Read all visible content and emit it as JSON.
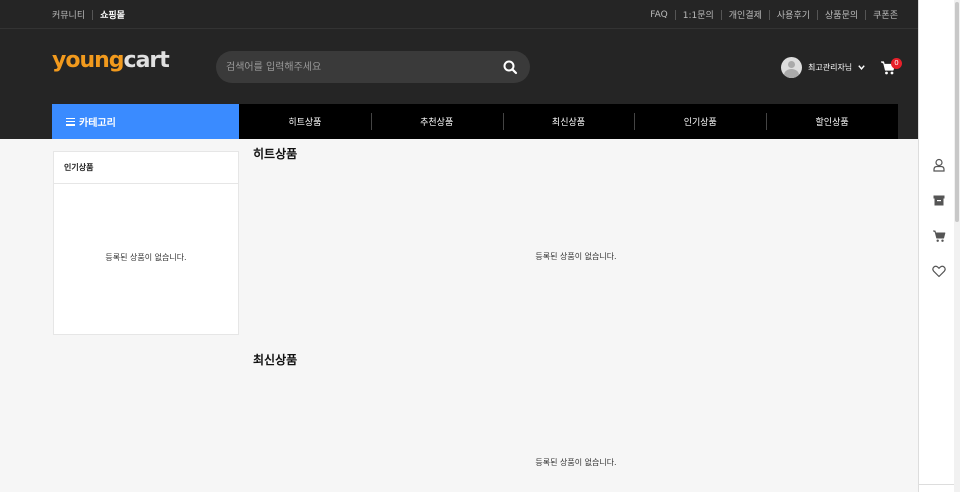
{
  "topbar": {
    "left_links": [
      "커뮤니티",
      "쇼핑몰"
    ],
    "right_links": [
      "FAQ",
      "1:1문의",
      "개인결제",
      "사용후기",
      "상품문의",
      "쿠폰존"
    ]
  },
  "logo": {
    "part1": "young",
    "part2": "cart"
  },
  "search": {
    "placeholder": "검색어를 입력해주세요"
  },
  "user": {
    "name": "최고관리자님"
  },
  "cart": {
    "count": "0"
  },
  "nav": {
    "category_label": "카테고리",
    "menu": [
      "히트상품",
      "추천상품",
      "최신상품",
      "인기상품",
      "할인상품"
    ]
  },
  "side_box": {
    "title": "인기상품",
    "empty_text": "등록된 상품이 없습니다."
  },
  "sections": [
    {
      "title": "히트상품",
      "empty_text": "등록된 상품이 없습니다."
    },
    {
      "title": "최신상품",
      "empty_text": "등록된 상품이 없습니다."
    }
  ],
  "colors": {
    "accent": "#3a8bff",
    "logo_orange": "#f29a1d",
    "header_bg": "#252525",
    "badge": "#e8202a"
  },
  "quickbar_icons": [
    "user-icon",
    "archive-box-icon",
    "cart-icon",
    "heart-icon"
  ]
}
